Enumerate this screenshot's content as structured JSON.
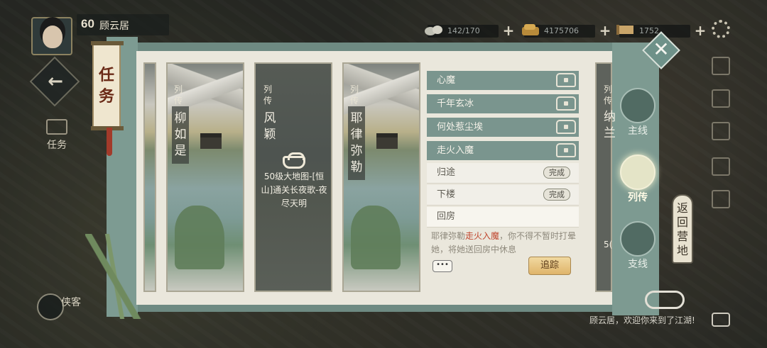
{
  "player": {
    "level": "60",
    "name": "顾云居"
  },
  "resources": [
    {
      "icon": "stone-icon",
      "value": "142/170"
    },
    {
      "icon": "coins-icon",
      "value": "4175706"
    },
    {
      "icon": "scroll-icon",
      "value": "1752"
    }
  ],
  "panel_title": [
    "任",
    "务"
  ],
  "left_menu": {
    "task_label": "任务",
    "xiake_label": "侠客"
  },
  "cards": [
    {
      "tag": [
        "列",
        "传"
      ],
      "name": [
        "柳",
        "如",
        "是"
      ],
      "locked": false
    },
    {
      "tag": [
        "列",
        "传"
      ],
      "name": [
        "风",
        "颖"
      ],
      "locked": true,
      "requirement": "50级大地图-[恒山]通关长夜歌-夜尽天明"
    },
    {
      "tag": [
        "列",
        "传"
      ],
      "name": [
        "耶",
        "律",
        "弥",
        "勒"
      ],
      "locked": false
    }
  ],
  "partial_card_right": {
    "tag": [
      "列",
      "传"
    ],
    "name": [
      "纳",
      "兰"
    ],
    "level_fragment": "5("
  },
  "quests_main": [
    "心魔",
    "千年玄冰",
    "何处惹尘埃",
    "走火入魔"
  ],
  "quests_steps": [
    {
      "label": "归途",
      "status": "完成"
    },
    {
      "label": "下楼",
      "status": "完成"
    },
    {
      "label": "回房",
      "status": ""
    }
  ],
  "description": {
    "before": "耶律弥勒",
    "highlight": "走火入魔",
    "after": "，你不得不暂时打晕她，将她送回房中休息"
  },
  "chat_mini": "•••",
  "track_label": "追踪",
  "tabs": [
    {
      "label": "主线",
      "selected": false
    },
    {
      "label": "列传",
      "selected": true
    },
    {
      "label": "支线",
      "selected": false
    }
  ],
  "close_label": "✕",
  "return_camp": [
    "返",
    "回",
    "营",
    "地"
  ],
  "welcome_text": "顾云居，欢迎你来到了江湖!"
}
